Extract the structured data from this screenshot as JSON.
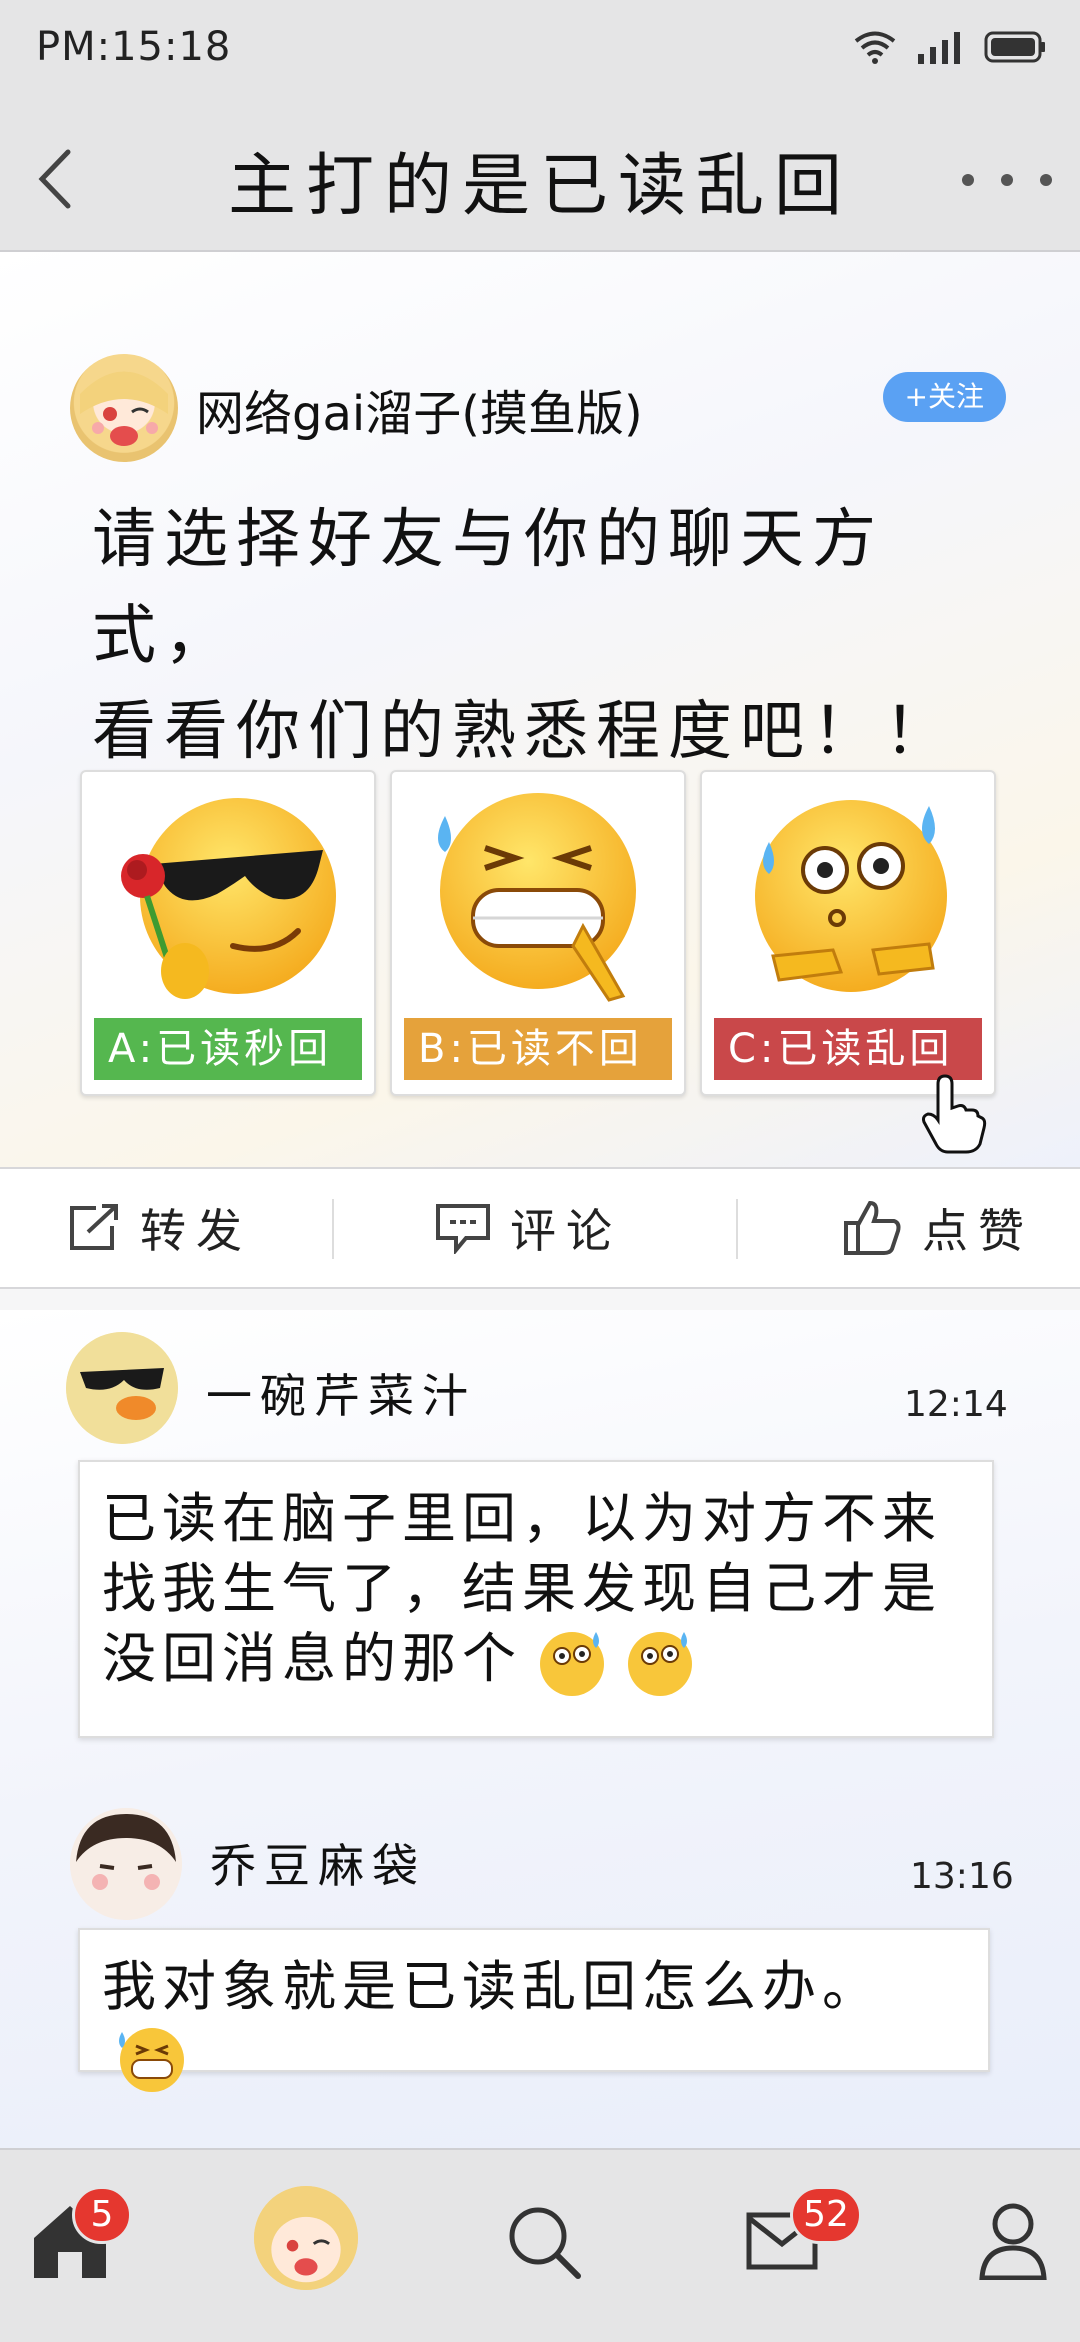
{
  "status_bar": {
    "time": "PM:15:18"
  },
  "header": {
    "title": "主打的是已读乱回"
  },
  "post": {
    "author": "网络gai溜子(摸鱼版)",
    "follow_label": "+关注",
    "text_line1": "请选择好友与你的聊天方式，",
    "text_line2": "看看你们的熟悉程度吧！！",
    "options": [
      {
        "label": "A:已读秒回",
        "color": "#55b74f",
        "emoji": "sunglasses-rose-emoji"
      },
      {
        "label": "B:已读不回",
        "color": "#e5a23b",
        "emoji": "sweat-grin-pray-emoji"
      },
      {
        "label": "C:已读乱回",
        "color": "#c9484a",
        "emoji": "dizzy-sweat-emoji"
      }
    ]
  },
  "actions": {
    "share": "转发",
    "comment": "评论",
    "like": "点赞"
  },
  "comments": [
    {
      "name": "一碗芹菜汁",
      "time": "12:14",
      "text": "已读在脑子里回，以为对方不来找我生气了，结果发现自己才是没回消息的那个"
    },
    {
      "name": "乔豆麻袋",
      "time": "13:16",
      "text": "我对象就是已读乱回怎么办。"
    }
  ],
  "tabbar": {
    "home_badge": "5",
    "mail_badge": "52"
  }
}
